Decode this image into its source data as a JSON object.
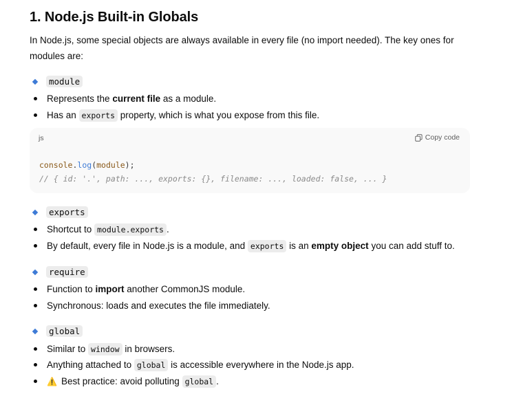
{
  "heading": "1. Node.js Built-in Globals",
  "intro": "In Node.js, some special objects are always available in every file (no import needed). The key ones for modules are:",
  "sections": {
    "module": {
      "name": "module",
      "b1_pre": "Represents the ",
      "b1_bold": "current file",
      "b1_post": " as a module.",
      "b2_pre": "Has an ",
      "b2_code": "exports",
      "b2_post": " property, which is what you expose from this file."
    },
    "code": {
      "lang": "js",
      "copy_label": "Copy code",
      "line1_obj": "console",
      "line1_dot": ".",
      "line1_fn": "log",
      "line1_paren_open": "(",
      "line1_arg": "module",
      "line1_paren_close": ");",
      "line2": "// { id: '.', path: ..., exports: {}, filename: ..., loaded: false, ... }"
    },
    "exports": {
      "name": "exports",
      "b1_pre": "Shortcut to ",
      "b1_code": "module.exports",
      "b1_post": ".",
      "b2_pre": "By default, every file in Node.js is a module, and ",
      "b2_code": "exports",
      "b2_mid": " is an ",
      "b2_bold": "empty object",
      "b2_post": " you can add stuff to."
    },
    "require": {
      "name": "require",
      "b1_pre": "Function to ",
      "b1_bold": "import",
      "b1_post": " another CommonJS module.",
      "b2": "Synchronous: loads and executes the file immediately."
    },
    "global": {
      "name": "global",
      "b1_pre": "Similar to ",
      "b1_code": "window",
      "b1_post": " in browsers.",
      "b2_pre": "Anything attached to ",
      "b2_code": "global",
      "b2_post": " is accessible everywhere in the Node.js app.",
      "b3_icon": "⚠️",
      "b3_pre": "Best practice: avoid polluting ",
      "b3_code": "global",
      "b3_post": "."
    }
  },
  "colors": {
    "accent_diamond": "#3e7bd6",
    "code_bg": "#f9f9f9",
    "inline_code_bg": "#ececec"
  }
}
